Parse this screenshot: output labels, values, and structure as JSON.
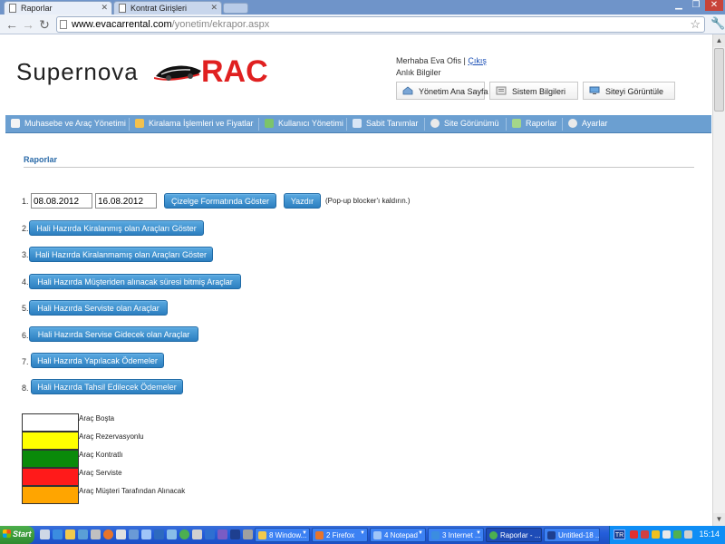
{
  "browser": {
    "tabs": [
      {
        "label": "Raporlar"
      },
      {
        "label": "Kontrat Girişleri"
      }
    ],
    "url_host": "www.evacarrental.com",
    "url_path": "/yonetim/ekrapor.aspx"
  },
  "header": {
    "logo_left": "Supernova",
    "logo_right": "RAC",
    "greeting_prefix": "Merhaba Eva Ofis | ",
    "logout": "Çıkış",
    "instant_info": "Anlık Bilgiler",
    "quick_buttons": [
      {
        "label": "Yönetim Ana Sayfa",
        "icon": "home-icon"
      },
      {
        "label": "Sistem Bilgileri",
        "icon": "info-icon"
      },
      {
        "label": "Siteyi Görüntüle",
        "icon": "monitor-icon"
      }
    ]
  },
  "menu": [
    {
      "label": "Muhasebe ve Araç Yönetimi",
      "icon": "calendar-icon"
    },
    {
      "label": "Kiralama İşlemleri ve Fiyatlar",
      "icon": "tag-icon"
    },
    {
      "label": "Kullanıcı Yönetimi",
      "icon": "user-icon"
    },
    {
      "label": "Sabit Tanımlar",
      "icon": "settings-icon"
    },
    {
      "label": "Site Görünümü",
      "icon": "gear-icon"
    },
    {
      "label": "Raporlar",
      "icon": "report-icon"
    },
    {
      "label": "Ayarlar",
      "icon": "gear-icon"
    }
  ],
  "section_title": "Raporlar",
  "reports": {
    "row1_number": "1.",
    "date_from": "08.08.2012",
    "date_to": "16.08.2012",
    "chart_button": "Çizelge Formatında Göster",
    "print_button": "Yazdır",
    "popup_note": "(Pop-up blocker'ı kaldırın.)",
    "items": [
      {
        "num": "2.",
        "label": "Hali Hazırda Kiralanmış olan Araçları Göster"
      },
      {
        "num": "3.",
        "label": "Hali Hazırda Kiralanmamış olan Araçları Göster"
      },
      {
        "num": "4.",
        "label": "Hali Hazırda Müşteriden alınacak süresi bitmiş Araçlar"
      },
      {
        "num": "5.",
        "label": "Hali Hazırda Serviste olan Araçlar"
      },
      {
        "num": "6.",
        "label": "Hali Hazırda  Servise Gidecek olan Araçlar"
      },
      {
        "num": "7.",
        "label": "Hali Hazırda Yapılacak Ödemeler"
      },
      {
        "num": "8.",
        "label": "Hali Hazırda Tahsil Edilecek Ödemeler"
      }
    ]
  },
  "legend": [
    {
      "label": "Araç Boşta",
      "color": "#ffffff"
    },
    {
      "label": "Araç Rezervasyonlu",
      "color": "#ffff00"
    },
    {
      "label": "Araç Kontratlı",
      "color": "#0a8a0a"
    },
    {
      "label": "Araç Serviste",
      "color": "#ff1a1a"
    },
    {
      "label": "Araç Müşteri Tarafından Alınacak",
      "color": "#ffa500"
    }
  ],
  "taskbar": {
    "start": "Start",
    "tasks": [
      {
        "label": "8 Window...",
        "color": "#f2c94c"
      },
      {
        "label": "2 Firefox",
        "color": "#e8742a"
      },
      {
        "label": "4 Notepad",
        "color": "#9fc5f8"
      },
      {
        "label": "3 Internet ...",
        "color": "#3b8de0"
      },
      {
        "label": "Raporlar - ...",
        "color": "#4caf50"
      },
      {
        "label": "Untitled-18 ...",
        "color": "#1e3f8f"
      }
    ],
    "lang": "TR",
    "clock": "15:14"
  }
}
